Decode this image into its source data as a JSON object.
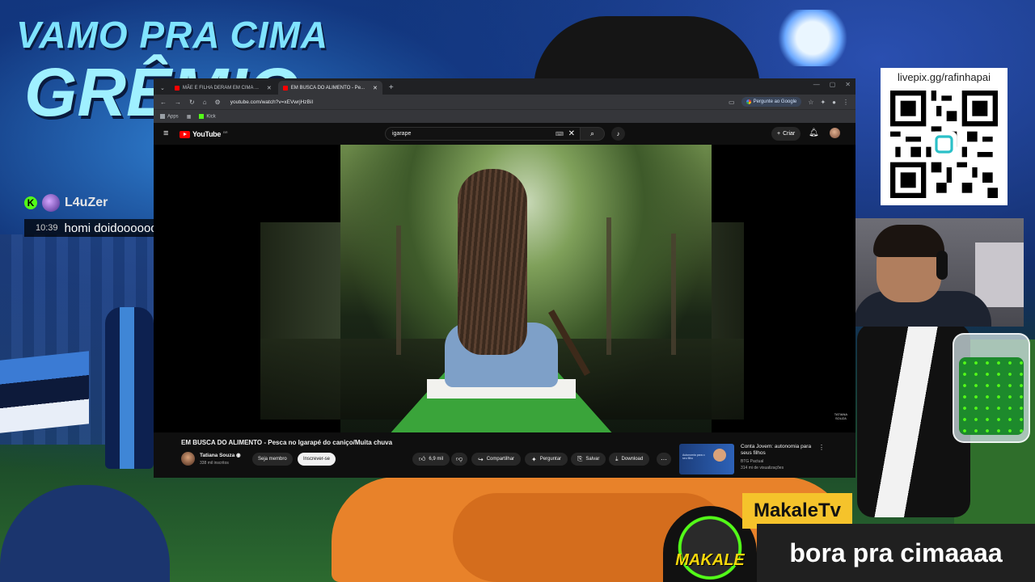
{
  "overlay": {
    "banner_line1": "VAMO PRA CIMA",
    "banner_line2": "GRÊMIO",
    "chat": {
      "username": "L4uZer",
      "platform_badge": "K",
      "time": "10:39",
      "message": "homi doidooooooooooooooooooooo"
    },
    "pix_url": "livepix.gg/rafinhapai",
    "streamer_name": "MakaleTv",
    "slogan": "bora pra cimaaaa",
    "mascot_text": "MAKALE",
    "colors": {
      "kick_green": "#53fc18",
      "name_tag": "#f5c32b"
    }
  },
  "browser": {
    "tabs": [
      {
        "label": "MÃE E FILHA DERAM EM CIMA ...",
        "active": false
      },
      {
        "label": "EM BUSCA DO ALIMENTO - Pe...",
        "active": true
      }
    ],
    "url": "youtube.com/watch?v=xEVwrjHzBiI",
    "ask_google": "Pergunte ao Google",
    "bookmarks": [
      "Apps",
      "Kick"
    ]
  },
  "youtube": {
    "logo": "YouTube",
    "region": "BR",
    "search_value": "igarape",
    "create_label": "Criar",
    "video": {
      "title": "EM BUSCA DO ALIMENTO - Pesca no Igarapé do caniço/Muita chuva",
      "watermark_line1": "TATIANA",
      "watermark_line2": "SOUZA"
    },
    "channel": {
      "name": "Tatiana Souza",
      "subscribers": "338 mil inscritos",
      "join_label": "Seja membro",
      "subscribe_label": "Inscrever-se"
    },
    "actions": {
      "likes": "6,9 mil",
      "share": "Compartilhar",
      "ask": "Perguntar",
      "save": "Salvar",
      "download": "Download"
    },
    "recommendation": {
      "title": "Conta Jovem: autonomia para seus filhos",
      "channel": "BTG Pactual",
      "views": "314 mi de visualizações",
      "thumb_text": "Autonomia para o seu filho"
    }
  }
}
